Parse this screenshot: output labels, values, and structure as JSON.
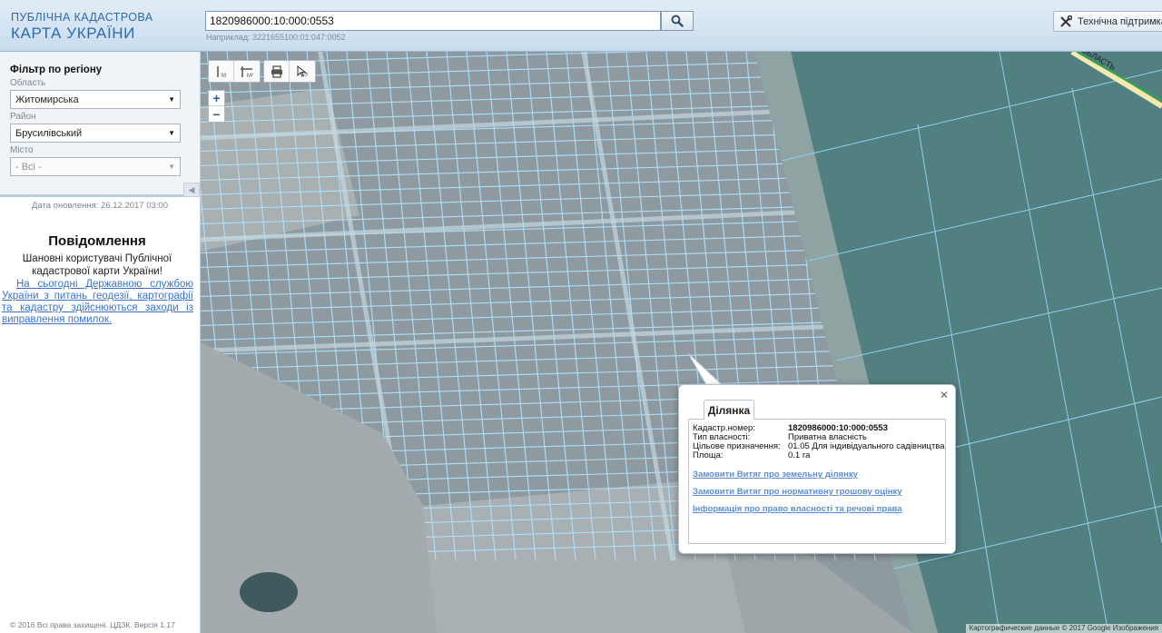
{
  "header": {
    "logo_line1": "ПУБЛІЧНА КАДАСТРОВА",
    "logo_line2": "КАРТА УКРАЇНИ",
    "search_value": "1820986000:10:000:0553",
    "search_hint": "Наприклад: 3221655100:01:047:0052",
    "support_label": "Технічна підтримка"
  },
  "sidebar": {
    "filter_title": "Фільтр по регіону",
    "oblast_label": "Область",
    "oblast_value": "Житомирська",
    "rayon_label": "Район",
    "rayon_value": "Брусилівський",
    "city_label": "Місто",
    "city_value": "- Всі -",
    "update_date": "Дата оновлення: 26.12.2017 03:00",
    "notice_title": "Повідомлення",
    "notice_text": "Шановні користувачі Публічної кадастрової карти України!",
    "notice_link": "На сьогодні Державною службою України з питань геодезії, картографії та кадастру здійснюються заходи із виправлення помилок.",
    "footer": "© 2016 Всі права захищені. ЦДЗК. Версія 1.17"
  },
  "map": {
    "region_label": "ОБЛАСТЬ",
    "attribution": "Картографические данные © 2017 Google Изображения",
    "parcel_line_color": "#aee3ff",
    "field_color": "#4e7f80"
  },
  "popup": {
    "tab_label": "Ділянка",
    "rows": [
      {
        "key": "Кадастр.номер:",
        "value": "1820986000:10:000:0553"
      },
      {
        "key": "Тип власності:",
        "value": "Приватна власність"
      },
      {
        "key": "Цільове призначення:",
        "value": "01.05 Для індивідуального садівництва"
      },
      {
        "key": "Площа:",
        "value": "0.1 га"
      }
    ],
    "links": [
      "Замовити Витяг про земельну ділянку",
      "Замовити Витяг про нормативну грошову оцінку",
      "Інформація про право власності та речові права"
    ]
  }
}
